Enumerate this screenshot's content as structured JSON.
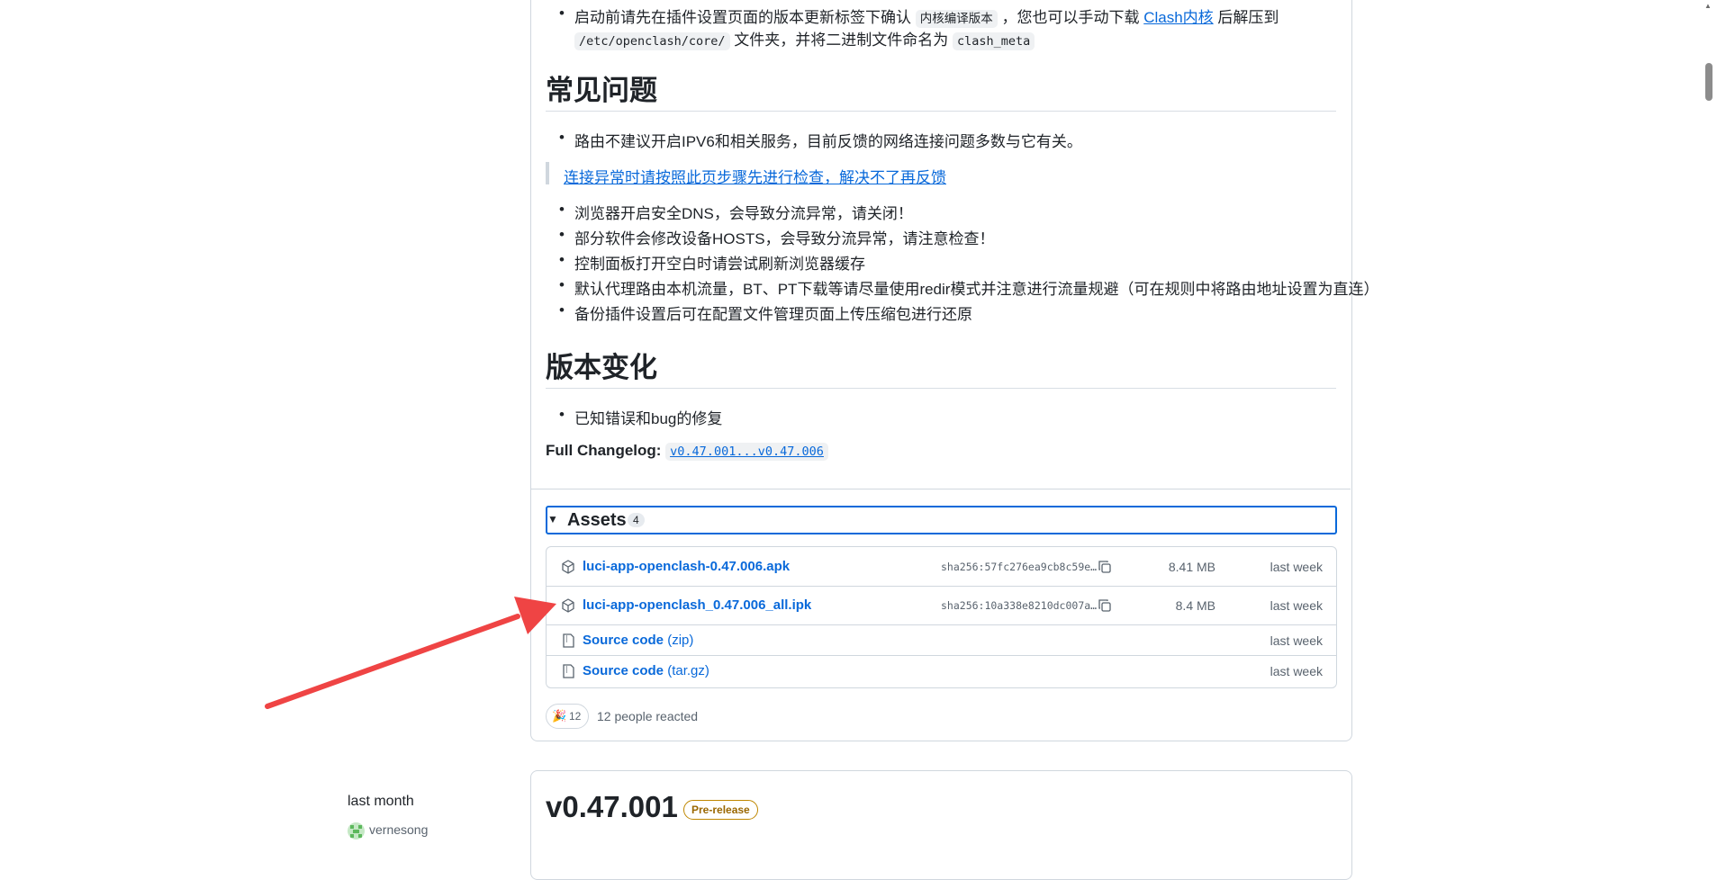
{
  "intro": {
    "line1_a": "启动前请先在插件设置页面的版本更新标签下确认",
    "line1_code": "内核编译版本",
    "line1_b": "，您也可以手动下载",
    "line1_link": "Clash内核",
    "line1_c": "后解压到",
    "line2_code": "/etc/openclash/core/",
    "line2_a": "文件夹，并将二进制文件命名为",
    "line2_code2": "clash_meta"
  },
  "faq": {
    "heading": "常见问题",
    "item1": "路由不建议开启IPV6和相关服务，目前反馈的网络连接问题多数与它有关。",
    "quote_link": "连接异常时请按照此页步骤先进行检查，解决不了再反馈",
    "items": [
      "浏览器开启安全DNS，会导致分流异常，请关闭！",
      "部分软件会修改设备HOSTS，会导致分流异常，请注意检查！",
      "控制面板打开空白时请尝试刷新浏览器缓存",
      "默认代理路由本机流量，BT、PT下载等请尽量使用redir模式并注意进行流量规避（可在规则中将路由地址设置为直连）",
      "备份插件设置后可在配置文件管理页面上传压缩包进行还原"
    ]
  },
  "changes": {
    "heading": "版本变化",
    "item1": "已知错误和bug的修复",
    "changelog_label": "Full Changelog:",
    "changelog_link": "v0.47.001...v0.47.006"
  },
  "assets": {
    "label": "Assets",
    "count": "4",
    "files": [
      {
        "name": "luci-app-openclash-0.47.006.apk",
        "sha": "sha256:57fc276ea9cb8c59e…",
        "size": "8.41 MB",
        "when": "last week"
      },
      {
        "name": "luci-app-openclash_0.47.006_all.ipk",
        "sha": "sha256:10a338e8210dc007a…",
        "size": "8.4 MB",
        "when": "last week"
      }
    ],
    "sources": [
      {
        "name": "Source code",
        "fmt": "(zip)",
        "when": "last week"
      },
      {
        "name": "Source code",
        "fmt": "(tar.gz)",
        "when": "last week"
      }
    ]
  },
  "reactions": {
    "emoji": "🎉",
    "count": "12",
    "text": "12 people reacted"
  },
  "next_release": {
    "time": "last month",
    "user": "vernesong",
    "title": "v0.47.001",
    "badge": "Pre-release"
  },
  "colors": {
    "link": "#0969da",
    "arrow": "#ef4444",
    "badge": "#9a6700"
  }
}
